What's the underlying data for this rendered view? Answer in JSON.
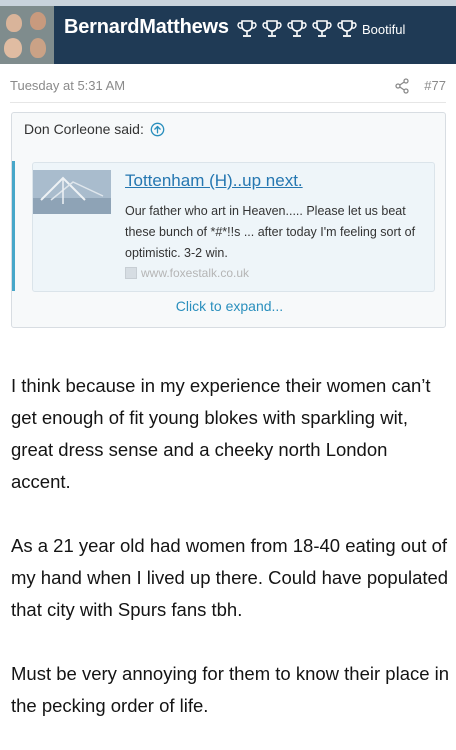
{
  "post": {
    "username": "BernardMatthews",
    "user_title": "Bootiful",
    "trophy_count": 5,
    "date": "Tuesday at 5:31 AM",
    "post_number": "#77"
  },
  "quote": {
    "attribution": "Don Corleone said:",
    "unfurl": {
      "title": "Tottenham (H)..up next.",
      "description": "Our father who art in Heaven..... Please let us beat these bunch of *#*!!s ... after today I'm feeling sort of optimistic. 3-2 win.",
      "domain": "www.foxestalk.co.uk"
    },
    "expand_label": "Click to expand..."
  },
  "message": {
    "paragraphs": [
      "I think because in my experience their women can’t get enough of fit young blokes with sparkling wit, great dress sense and a cheeky north London accent.",
      "As a 21 year old had women from 18-40 eating out of my hand when I lived up there. Could have populated that city with Spurs fans tbh.",
      "Must be very annoying for them to know their place in the pecking order of life."
    ]
  },
  "colors": {
    "header_bg": "#1f3a55",
    "accent": "#47a7c9",
    "link": "#2577b1"
  }
}
